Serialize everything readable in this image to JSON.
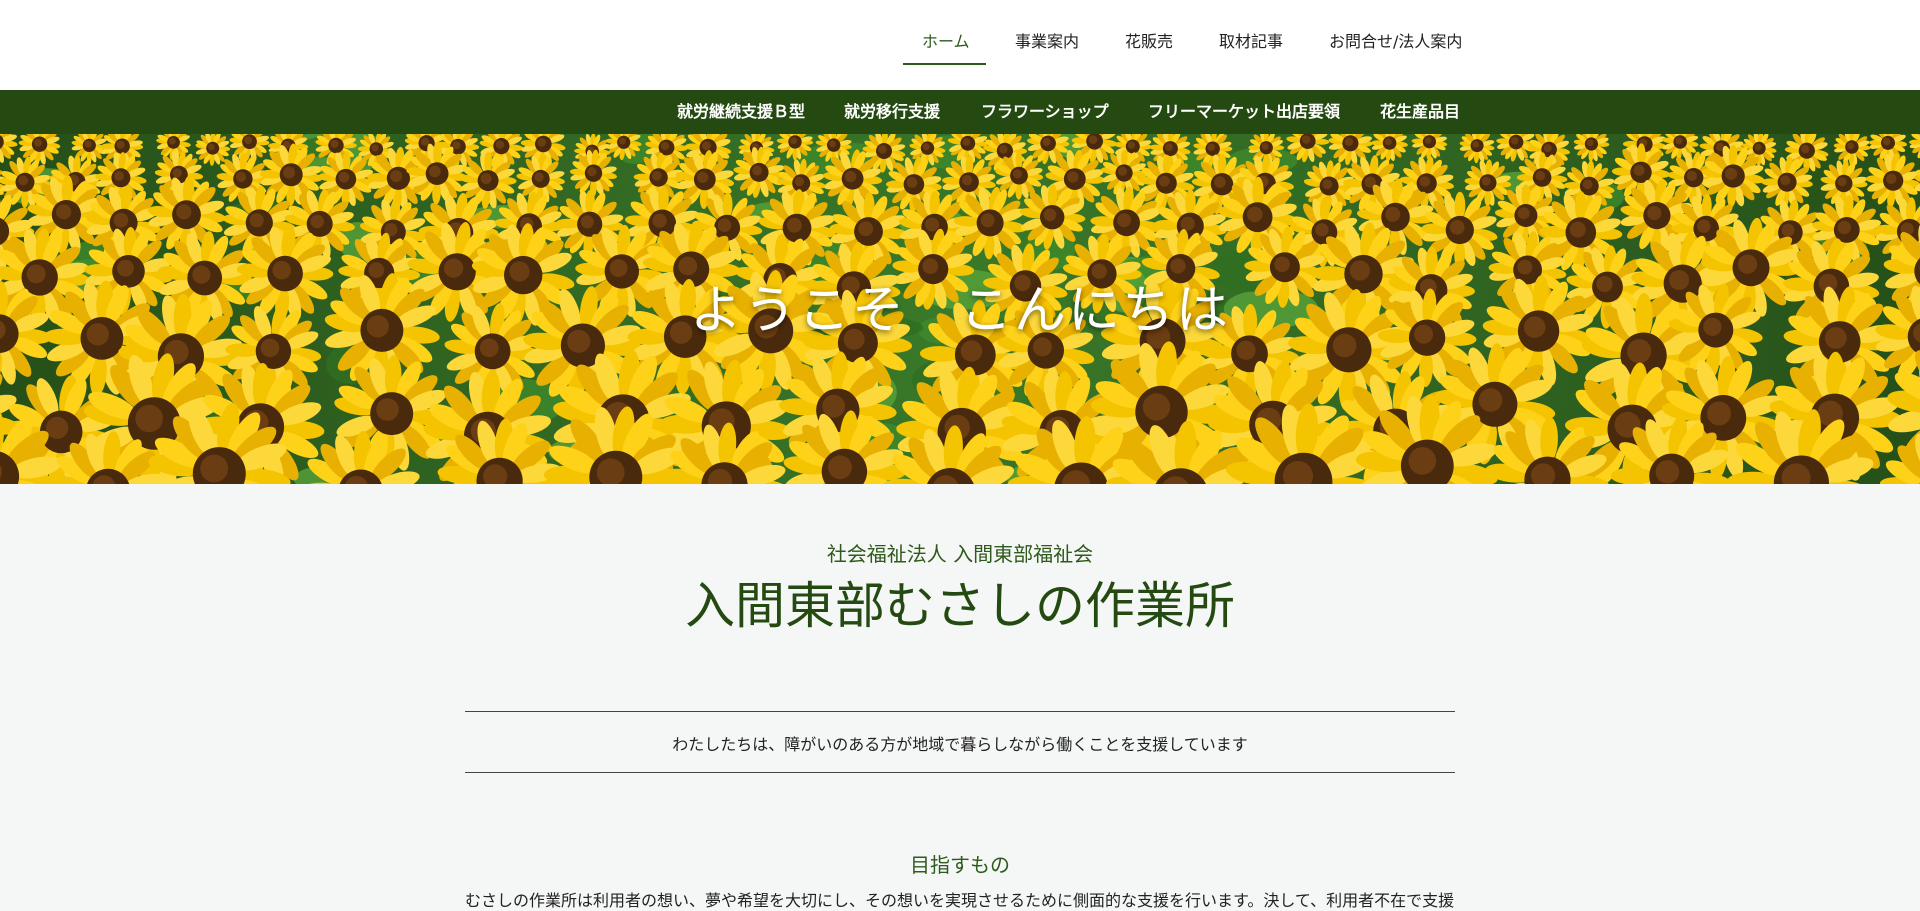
{
  "top_nav": {
    "items": [
      "ホーム",
      "事業案内",
      "花販売",
      "取材記事",
      "お問合せ/法人案内"
    ],
    "active_index": 0
  },
  "sub_nav": {
    "items": [
      "就労継続支援Ｂ型",
      "就労移行支援",
      "フラワーショップ",
      "フリーマーケット出店要領",
      "花生産品目"
    ]
  },
  "hero": {
    "welcome_text": "ようこそ　こんにちは"
  },
  "content": {
    "org_sub": "社会福祉法人 入間東部福祉会",
    "org_title": "入間東部むさしの作業所",
    "tagline": "わたしたちは、障がいのある方が地域で暮らしながら働くことを支援しています",
    "goal_title": "目指すもの",
    "goal_text": "むさしの作業所は利用者の想い、夢や希望を大切にし、その想いを実現させるために側面的な支援を行います。決して、利用者不在で支援"
  },
  "colors": {
    "accent": "#2e5a1c",
    "subnav_bg": "#244a12",
    "page_bg": "#f5f7f6"
  }
}
